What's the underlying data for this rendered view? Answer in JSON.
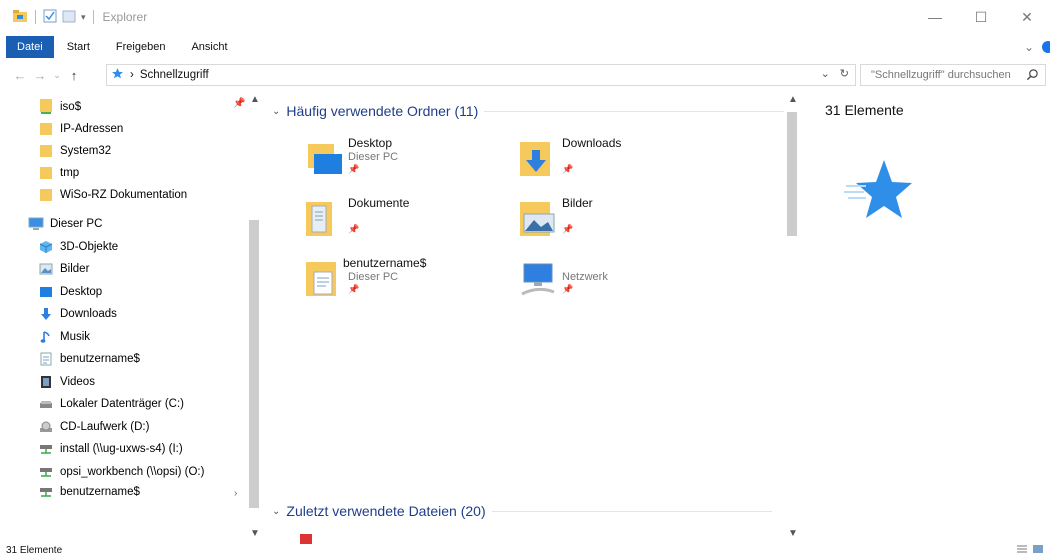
{
  "window": {
    "title": "Explorer",
    "controls": {
      "minimize": "—",
      "maximize": "☐",
      "close": "✕"
    }
  },
  "ribbon": {
    "tabs": [
      {
        "label": "Datei"
      },
      {
        "label": "Start"
      },
      {
        "label": "Freigeben"
      },
      {
        "label": "Ansicht"
      }
    ],
    "collapse": "⌄"
  },
  "nav": {
    "back": "←",
    "forward": "→",
    "recent": "⌄",
    "up": "↑",
    "path_sep": "›",
    "path": "Schnellzugriff",
    "dropdown": "⌄",
    "refresh": "↻"
  },
  "search": {
    "placeholder": "\"Schnellzugriff\" durchsuchen"
  },
  "sidebar": {
    "pinned": [
      {
        "label": "iso$"
      },
      {
        "label": "IP-Adressen"
      },
      {
        "label": "System32"
      },
      {
        "label": "tmp"
      },
      {
        "label": "WiSo-RZ Dokumentation"
      }
    ],
    "this_pc": {
      "label": "Dieser PC"
    },
    "pc_items": [
      {
        "label": "3D-Objekte"
      },
      {
        "label": "Bilder"
      },
      {
        "label": "Desktop"
      },
      {
        "label": "Downloads"
      },
      {
        "label": "Musik"
      },
      {
        "label": "benutzername$"
      },
      {
        "label": "Videos"
      },
      {
        "label": "Lokaler Datenträger (C:)"
      },
      {
        "label": "CD-Laufwerk (D:)"
      },
      {
        "label": "install (\\\\ug-uxws-s4) (I:)"
      },
      {
        "label": "opsi_workbench (\\\\opsi) (O:)"
      },
      {
        "label": "benutzername$"
      }
    ]
  },
  "main": {
    "frequent": {
      "title": "Häufig verwendete Ordner (11)",
      "tiles": [
        {
          "name": "Desktop",
          "sub": "Dieser PC"
        },
        {
          "name": "Downloads",
          "sub": ""
        },
        {
          "name": "Dokumente",
          "sub": ""
        },
        {
          "name": "Bilder",
          "sub": ""
        },
        {
          "name": "benutzername$",
          "sub": "Dieser PC"
        },
        {
          "name": "Netzwerk",
          "sub": ""
        }
      ]
    },
    "recent": {
      "title": "Zuletzt verwendete Dateien (20)"
    }
  },
  "details": {
    "count": "31 Elemente"
  },
  "status": {
    "text": "31 Elemente"
  },
  "colors": {
    "accent": "#1a5fb4",
    "folder": "#f5c95b",
    "header": "#1e3e8a",
    "star": "#2f8fe8"
  }
}
